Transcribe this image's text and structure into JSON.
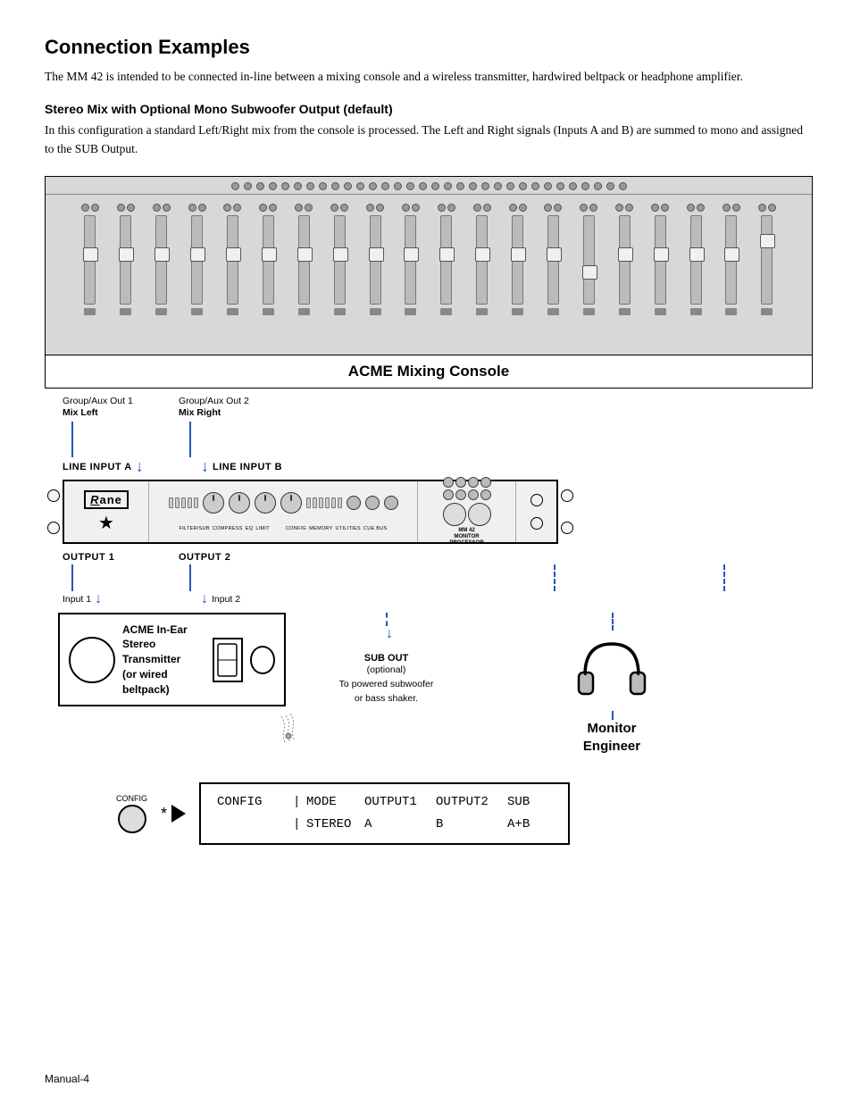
{
  "page": {
    "title": "Connection Examples",
    "footer": "Manual-4"
  },
  "intro": {
    "text": "The MM 42 is intended to be connected in-line between a mixing console and a wireless transmitter, hardwired beltpack or headphone amplifier."
  },
  "section1": {
    "title": "Stereo Mix with Optional Mono Subwoofer Output (default)",
    "body": "In this configuration a standard Left/Right mix from the console is processed. The Left and Right signals (Inputs A and B) are summed to mono and assigned to the SUB Output."
  },
  "console": {
    "label": "ACME Mixing Console",
    "output1_label": "Group/Aux Out 1",
    "output1_sub": "Mix Left",
    "output2_label": "Group/Aux Out 2",
    "output2_sub": "Mix Right",
    "line_input_a": "LINE INPUT A",
    "line_input_b": "LINE INPUT B"
  },
  "rane_device": {
    "brand": "Rane",
    "star": "★",
    "model": "MM 42\nMONITOR\nPROCESSOR",
    "labels": [
      "FILTER/SUB",
      "COMPRESS",
      "EQ",
      "LIMIT",
      "CONFIG",
      "MEMORY",
      "UTILITIES",
      "CUE BUS"
    ]
  },
  "outputs": {
    "output1": "OUTPUT 1",
    "output2": "OUTPUT 2",
    "input1": "Input 1",
    "input2": "Input 2"
  },
  "in_ear": {
    "label": "ACME In-Ear\nStereo Transmitter\n(or wired beltpack)"
  },
  "sub_out": {
    "label": "SUB OUT",
    "sub": "(optional)\nTo powered subwoofer\nor bass shaker."
  },
  "monitor": {
    "label": "Monitor\nEngineer"
  },
  "config_table": {
    "header_col1": "CONFIG",
    "header_sep": "|",
    "header_col2": "MODE",
    "header_col3": "OUTPUT1",
    "header_col4": "OUTPUT2",
    "header_col5": "SUB",
    "data_col1": "",
    "data_sep": "|",
    "data_col2": "STEREO",
    "data_col3": "A",
    "data_col4": "B",
    "data_col5": "A+B",
    "config_label": "CONFIG",
    "star": "*"
  }
}
